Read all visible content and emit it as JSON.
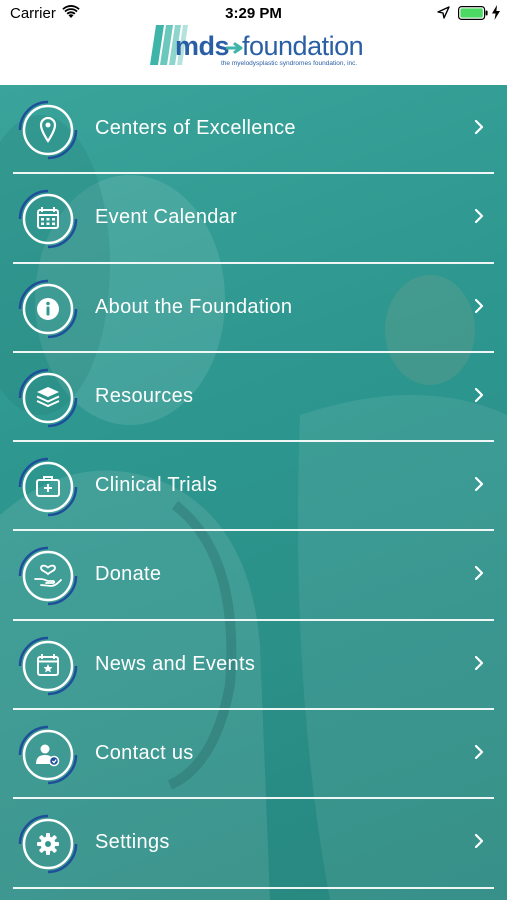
{
  "status_bar": {
    "carrier": "Carrier",
    "time": "3:29 PM",
    "battery_color": "#4cd964"
  },
  "header": {
    "logo_word_1": "mds",
    "logo_word_2": "foundation",
    "logo_tagline": "the myelodysplastic syndromes foundation, inc.",
    "brand_color": "#2a5ea5",
    "accent_color": "#3eb5a8"
  },
  "menu": {
    "items": [
      {
        "label": "Centers of Excellence",
        "icon": "location-pin-icon"
      },
      {
        "label": "Event Calendar",
        "icon": "calendar-icon"
      },
      {
        "label": "About the Foundation",
        "icon": "info-icon"
      },
      {
        "label": "Resources",
        "icon": "layers-icon"
      },
      {
        "label": "Clinical Trials",
        "icon": "medical-kit-icon"
      },
      {
        "label": "Donate",
        "icon": "heart-hand-icon"
      },
      {
        "label": "News and Events",
        "icon": "calendar-star-icon"
      },
      {
        "label": "Contact us",
        "icon": "contact-person-icon"
      },
      {
        "label": "Settings",
        "icon": "gear-icon"
      }
    ]
  },
  "theme": {
    "overlay_color": "#2f9990"
  }
}
